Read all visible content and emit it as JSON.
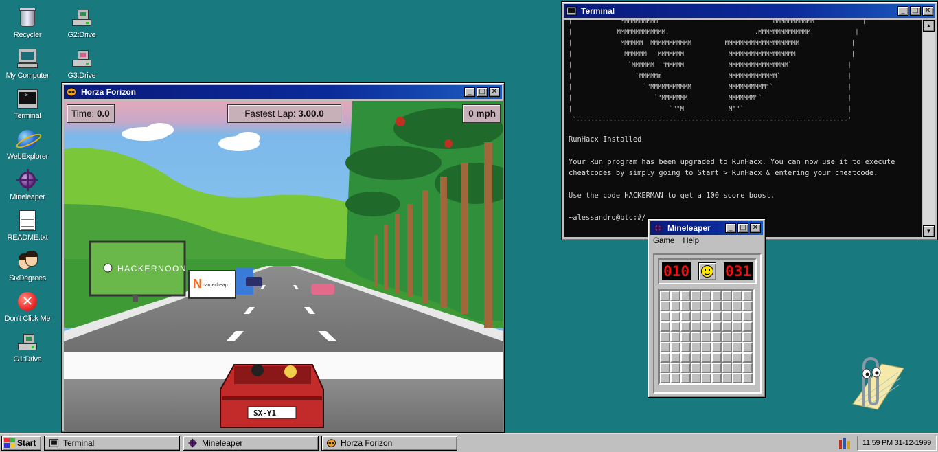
{
  "desktop": {
    "icons": [
      {
        "id": "recycler",
        "label": "Recycler",
        "icon": "recycle-bin-icon"
      },
      {
        "id": "my-computer",
        "label": "My Computer",
        "icon": "computer-icon"
      },
      {
        "id": "terminal",
        "label": "Terminal",
        "icon": "terminal-icon"
      },
      {
        "id": "webexplorer",
        "label": "WebExplorer",
        "icon": "globe-icon"
      },
      {
        "id": "mineleaper",
        "label": "Mineleaper",
        "icon": "mine-icon"
      },
      {
        "id": "readme",
        "label": "README.txt",
        "icon": "text-file-icon"
      },
      {
        "id": "sixdegrees",
        "label": "SixDegrees",
        "icon": "people-icon"
      },
      {
        "id": "dont-click",
        "label": "Don't Click Me",
        "icon": "stop-icon"
      },
      {
        "id": "g1-drive",
        "label": "G1:Drive",
        "icon": "drive-icon"
      },
      {
        "id": "g2-drive",
        "label": "G2:Drive",
        "icon": "drive-icon"
      },
      {
        "id": "g3-drive",
        "label": "G3:Drive",
        "icon": "drive-icon"
      }
    ]
  },
  "terminal": {
    "title": "Terminal",
    "art": [
      "|            `MMMMMMMMMM                               MMMMMMMMMMM`            |",
      "|            MMMMMMMMMMMMM.                       .MMMMMMMMMMMMMM            |",
      "|             MMMMMM  MMMMMMMMMMM         MMMMMMMMMMMMMMMMMMMM              |",
      "|              MMMMMM  'MMMMMMM            MMMMMMMMMMMMMMMMMM               |",
      "|               `MMMMMM  \"MMMMM            MMMMMMMMMMMMMMMM`               |",
      "|                 `MMMMMm                  MMMMMMMMMMMMM`                  |",
      "|                   `\"MMMMMMMMMMM          MMMMMMMMMM\"`                    |",
      "|                      `\"MMMMMMM           MMMMMMM\"`                       |",
      "|                          `\"\"M            M\"\"`                            |",
      " `-------------------------------------------------------------------------' "
    ],
    "lines": [
      "RunHacx Installed",
      "Your Run program has been upgraded to RunHacx. You can now use it to execute cheatcodes by simply going to Start > RunHacx & entering your cheatcode.",
      "Use the code HACKERMAN to get a 100 score boost.",
      "~alessandro@btc:#/"
    ]
  },
  "game": {
    "title": "Horza Forizon",
    "time_label": "Time:",
    "time_value": "0.0",
    "fastest_label": "Fastest Lap:",
    "fastest_value": "3.00.0",
    "speed": "0 mph",
    "billboard_left": "HACKERNOON",
    "billboard_right": "namecheap",
    "plate": "SX-Y1"
  },
  "mineleaper": {
    "title": "Mineleaper",
    "menu": [
      "Game",
      "Help"
    ],
    "mines_left": "010",
    "timer": "031",
    "grid_size": 9
  },
  "taskbar": {
    "start_label": "Start",
    "tasks": [
      {
        "label": "Terminal",
        "icon": "terminal-icon"
      },
      {
        "label": "Mineleaper",
        "icon": "mine-icon"
      },
      {
        "label": "Horza Forizon",
        "icon": "game-icon"
      }
    ],
    "clock": "11:59 PM  31-12-1999"
  },
  "colors": {
    "desktop": "#18797f",
    "titlebar": "#0a1a7a",
    "lcd_red": "#f01010"
  }
}
